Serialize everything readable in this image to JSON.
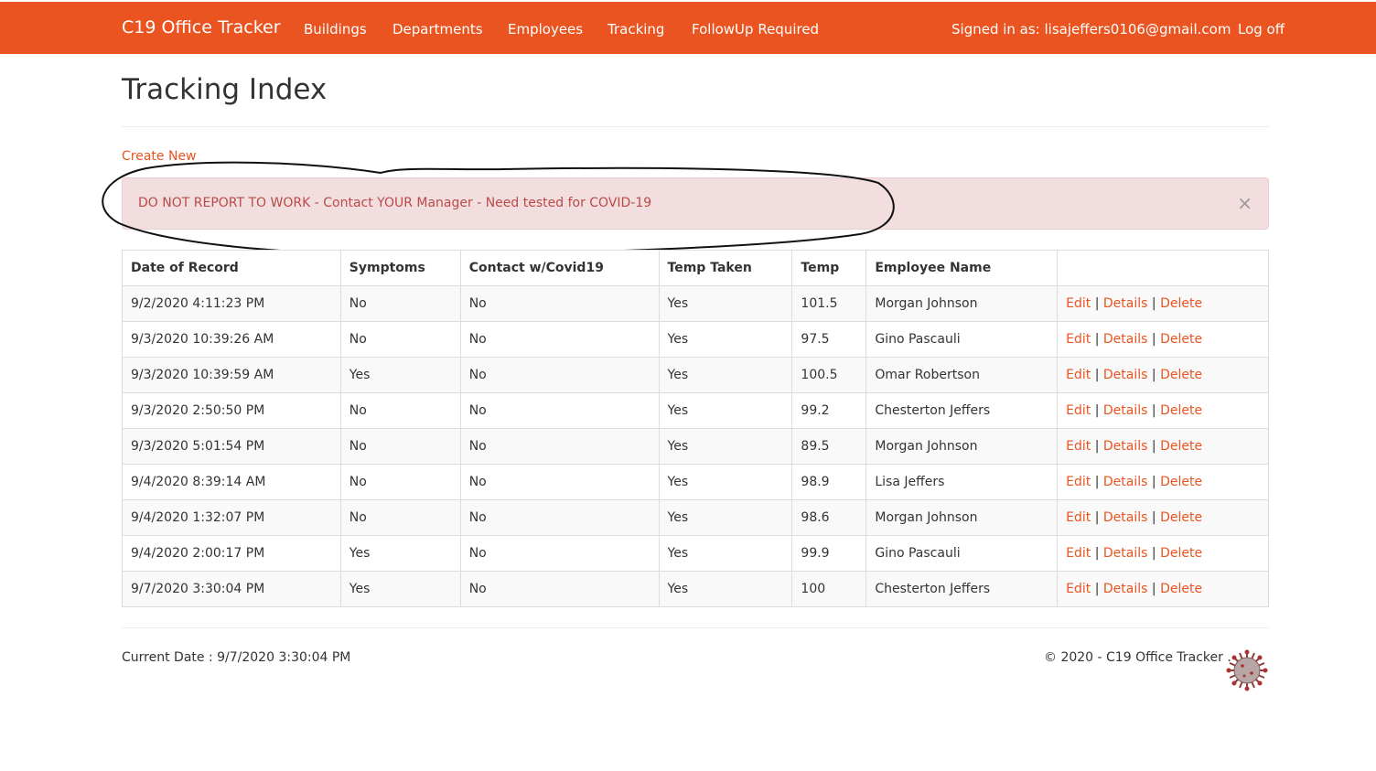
{
  "navbar": {
    "brand": "C19 Office Tracker",
    "links": [
      "Buildings",
      "Departments",
      "Employees",
      "Tracking",
      "FollowUp Required"
    ],
    "signed_in": "Signed in as: lisajeffers0106@gmail.com",
    "logoff": "Log off"
  },
  "page": {
    "title": "Tracking Index",
    "create_new": "Create New"
  },
  "alert": {
    "text": "DO NOT REPORT TO WORK - Contact YOUR Manager - Need tested for COVID-19",
    "close": "×"
  },
  "table": {
    "headers": [
      "Date of Record",
      "Symptoms",
      "Contact w/Covid19",
      "Temp Taken",
      "Temp",
      "Employee Name",
      ""
    ],
    "actions": {
      "edit": "Edit",
      "details": "Details",
      "delete": "Delete",
      "sep": "|"
    },
    "rows": [
      [
        "9/2/2020 4:11:23 PM",
        "No",
        "No",
        "Yes",
        "101.5",
        "Morgan Johnson"
      ],
      [
        "9/3/2020 10:39:26 AM",
        "No",
        "No",
        "Yes",
        "97.5",
        "Gino Pascauli"
      ],
      [
        "9/3/2020 10:39:59 AM",
        "Yes",
        "No",
        "Yes",
        "100.5",
        "Omar Robertson"
      ],
      [
        "9/3/2020 2:50:50 PM",
        "No",
        "No",
        "Yes",
        "99.2",
        "Chesterton Jeffers"
      ],
      [
        "9/3/2020 5:01:54 PM",
        "No",
        "No",
        "Yes",
        "89.5",
        "Morgan Johnson"
      ],
      [
        "9/4/2020 8:39:14 AM",
        "No",
        "No",
        "Yes",
        "98.9",
        "Lisa Jeffers"
      ],
      [
        "9/4/2020 1:32:07 PM",
        "No",
        "No",
        "Yes",
        "98.6",
        "Morgan Johnson"
      ],
      [
        "9/4/2020 2:00:17 PM",
        "Yes",
        "No",
        "Yes",
        "99.9",
        "Gino Pascauli"
      ],
      [
        "9/7/2020 3:30:04 PM",
        "Yes",
        "No",
        "Yes",
        "100",
        "Chesterton Jeffers"
      ]
    ]
  },
  "footer": {
    "current_date": "Current Date : 9/7/2020 3:30:04 PM",
    "copyright": "© 2020 - C19 Office Tracker ."
  },
  "colors": {
    "brand": "#e95420",
    "alert_bg": "#f2dede",
    "alert_text": "#b94a48"
  },
  "icons": {
    "footer_logo": "coronavirus-icon",
    "alert_annotation": "hand-drawn-ellipse"
  }
}
